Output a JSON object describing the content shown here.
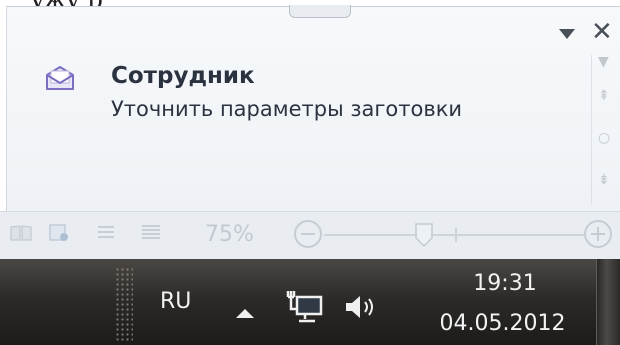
{
  "background_document": {
    "visible_text": "ужу                                                               р"
  },
  "notification": {
    "sender": "Сотрудник",
    "subject": "Уточнить параметры заготовки",
    "icons": {
      "envelope": "envelope-icon",
      "menu": "dropdown-arrow-icon",
      "close": "close-icon"
    },
    "close_glyph": "✕"
  },
  "status_bar": {
    "zoom_percent": "75%",
    "zoom_level": 0.75
  },
  "taskbar": {
    "language": "RU",
    "clock": {
      "time": "19:31",
      "date": "04.05.2012"
    },
    "tray_icons": [
      "show-hidden-icons-arrow",
      "network-icon",
      "volume-icon"
    ]
  },
  "colors": {
    "taskbar_top": "#4b4744",
    "taskbar_bottom": "#1c1b1a",
    "popup_bg": "#f2f5f8",
    "text_dark": "#2c3340",
    "envelope_accent": "#7b6ec3"
  }
}
